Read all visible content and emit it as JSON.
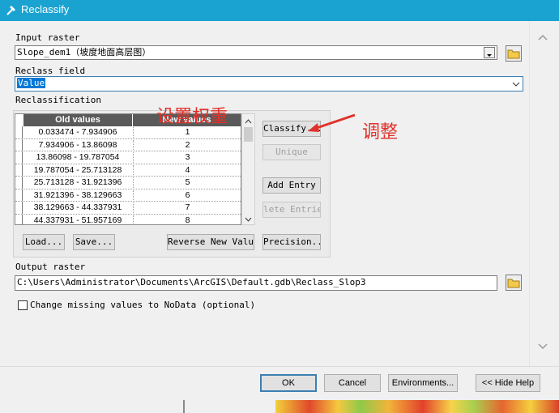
{
  "window": {
    "title": "Reclassify"
  },
  "input_raster": {
    "label": "Input raster",
    "value": "Slope_dem1（坡度地面高层图）"
  },
  "reclass_field": {
    "label": "Reclass field",
    "value": "Value"
  },
  "reclassification": {
    "label": "Reclassification",
    "columns": [
      "Old values",
      "New values"
    ],
    "rows": [
      {
        "old": "0.033474 - 7.934906",
        "new": "1"
      },
      {
        "old": "7.934906 - 13.86098",
        "new": "2"
      },
      {
        "old": "13.86098 - 19.787054",
        "new": "3"
      },
      {
        "old": "19.787054 - 25.713128",
        "new": "4"
      },
      {
        "old": "25.713128 - 31.921396",
        "new": "5"
      },
      {
        "old": "31.921396 - 38.129663",
        "new": "6"
      },
      {
        "old": "38.129663 - 44.337931",
        "new": "7"
      },
      {
        "old": "44.337931 - 51.957169",
        "new": "8"
      }
    ],
    "buttons": {
      "classify": "Classify...",
      "unique": "Unique",
      "add_entry": "Add Entry",
      "delete_entries": "lete Entrie",
      "load": "Load...",
      "save": "Save...",
      "reverse": "Reverse New Values",
      "precision": "Precision..."
    }
  },
  "output_raster": {
    "label": "Output raster",
    "value": "C:\\Users\\Administrator\\Documents\\ArcGIS\\Default.gdb\\Reclass_Slop3"
  },
  "missing_values": {
    "label": "Change missing values to NoData (optional)",
    "checked": false
  },
  "footer": {
    "ok": "OK",
    "cancel": "Cancel",
    "environments": "Environments...",
    "hide_help": "<< Hide Help"
  },
  "annotations": {
    "set_weight": "设置权重",
    "adjust": "调整",
    "color": "#e0322a"
  }
}
